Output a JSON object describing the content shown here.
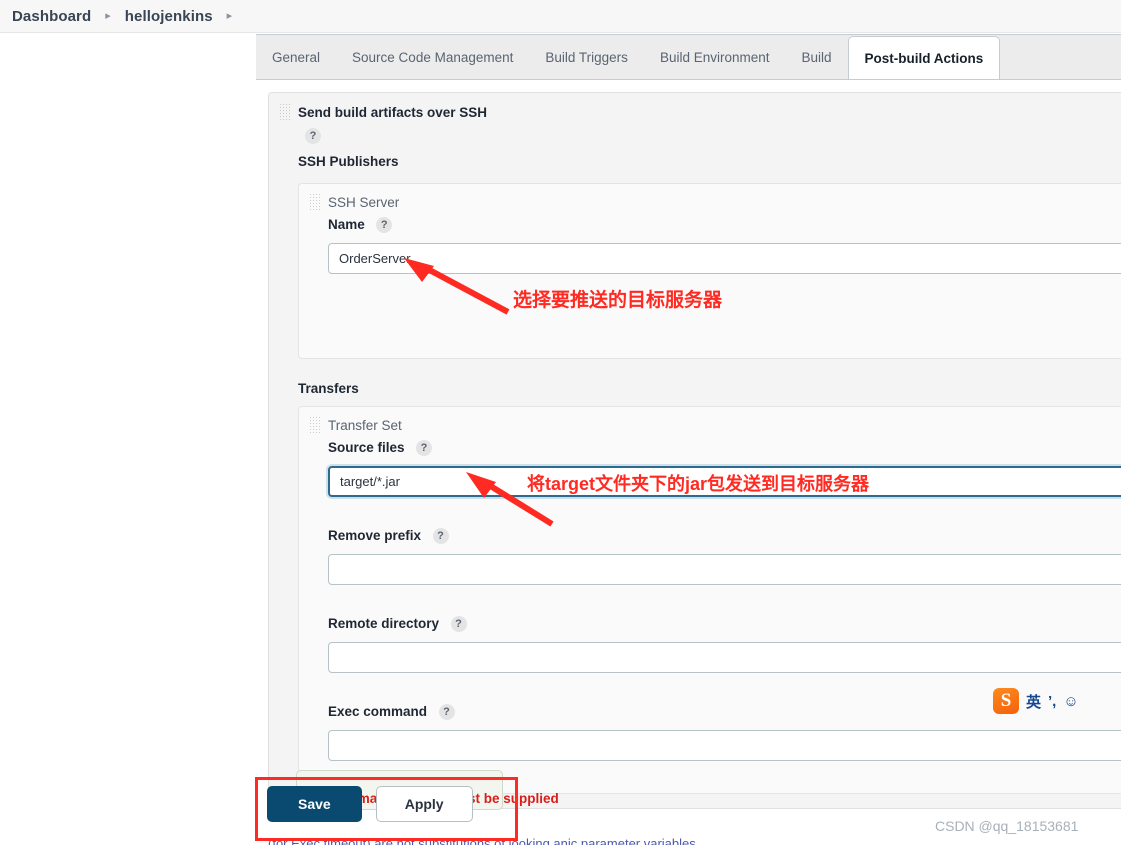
{
  "breadcrumb": {
    "items": [
      {
        "label": "Dashboard"
      },
      {
        "label": "hellojenkins"
      }
    ],
    "separator": "▸"
  },
  "tabs": [
    {
      "label": "General",
      "active": false
    },
    {
      "label": "Source Code Management",
      "active": false
    },
    {
      "label": "Build Triggers",
      "active": false
    },
    {
      "label": "Build Environment",
      "active": false
    },
    {
      "label": "Build",
      "active": false
    },
    {
      "label": "Post-build Actions",
      "active": true
    }
  ],
  "post_build": {
    "section_title": "Send build artifacts over SSH",
    "help_glyph": "?",
    "ssh_publishers_label": "SSH Publishers",
    "ssh_server": {
      "panel_label": "SSH Server",
      "name_label": "Name",
      "name_value": "OrderServer"
    },
    "transfers": {
      "group_label": "Transfers",
      "panel_label": "Transfer Set",
      "fields": [
        {
          "label": "Source files",
          "value": "target/*.jar",
          "focused": true
        },
        {
          "label": "Remove prefix",
          "value": "",
          "focused": false
        },
        {
          "label": "Remote directory",
          "value": "",
          "focused": false
        },
        {
          "label": "Exec command",
          "value": "",
          "focused": false
        }
      ]
    }
  },
  "annotations": [
    {
      "id": "select-target-server",
      "text": "选择要推送的目标服务器"
    },
    {
      "id": "send-jar-to-server",
      "text": "将target文件夹下的jar包发送到目标服务器"
    }
  ],
  "footer": {
    "save_label": "Save",
    "apply_label": "Apply",
    "error_message": "command or both must be supplied",
    "bottom_note": "(for Exec timeout) are not substitutions of looking anic parameter variables"
  },
  "ime": {
    "logo_glyph": "S",
    "mode_label": "英",
    "punct_label": "’,",
    "emoji_label": "☺"
  },
  "watermark": "CSDN @qq_18153681",
  "colors": {
    "accent_navy": "#0b4a70",
    "annotation_red": "#ff2a21",
    "error_red": "#d7201a",
    "focus_blue": "#2c6b8e",
    "breadcrumb_bg": "#f7f7f7",
    "tab_strip_bg": "#ececec"
  }
}
